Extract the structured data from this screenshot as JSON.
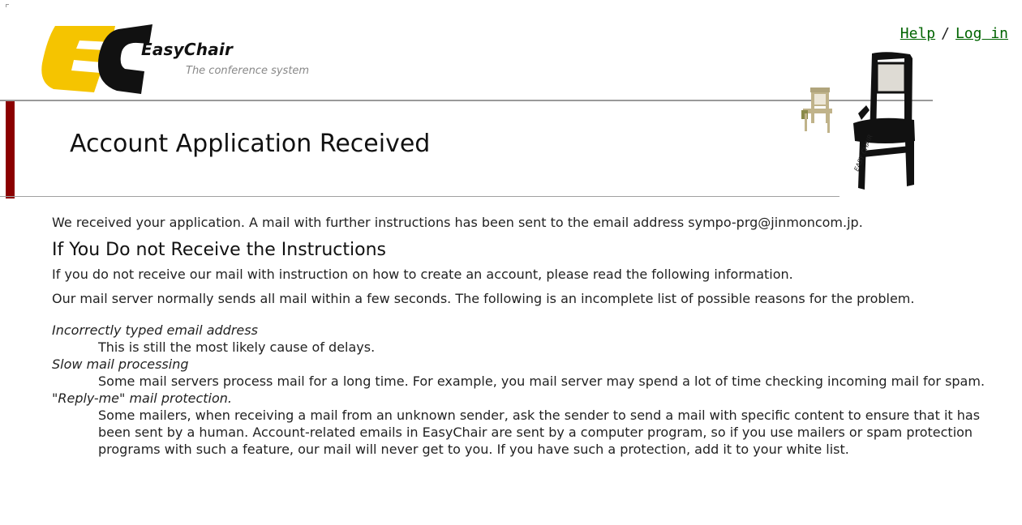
{
  "header": {
    "logo_name": "EasyChair",
    "logo_tagline": "The conference system",
    "help_link": "Help",
    "separator": "/",
    "login_link": "Log in",
    "chair_label": "EASY CHAIR"
  },
  "page": {
    "title": "Account Application Received"
  },
  "content": {
    "intro": "We received your application. A mail with further instructions has been sent to the email address sympo-prg@jinmoncom.jp.",
    "section_heading": "If You Do not Receive the Instructions",
    "para1": "If you do not receive our mail with instruction on how to create an account, please read the following information.",
    "para2": "Our mail server normally sends all mail within a few seconds. The following is an incomplete list of possible reasons for the problem.",
    "reasons": [
      {
        "term": "Incorrectly typed email address",
        "description": "This is still the most likely cause of delays."
      },
      {
        "term": "Slow mail processing",
        "description": "Some mail servers process mail for a long time. For example, you mail server may spend a lot of time checking incoming mail for spam."
      },
      {
        "term": "\"Reply-me\" mail protection.",
        "description": "Some mailers, when receiving a mail from an unknown sender, ask the sender to send a mail with specific content to ensure that it has been sent by a human. Account-related emails in EasyChair are sent by a computer program, so if you use mailers or spam protection programs with such a feature, our mail will never get to you. If you have such a protection, add it to your white list."
      }
    ]
  },
  "colors": {
    "link": "#006400",
    "logo_yellow": "#f5c400",
    "banner_bar": "#8b0000",
    "small_chair": "#c0b38a"
  }
}
